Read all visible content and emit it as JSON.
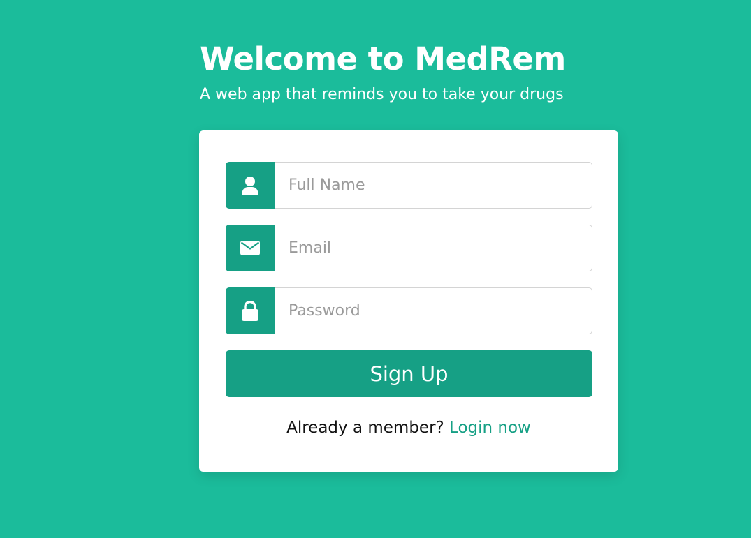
{
  "header": {
    "title": "Welcome to MedRem",
    "subtitle": "A web app that reminds you to take your drugs"
  },
  "form": {
    "fields": [
      {
        "name": "full-name",
        "icon": "user-icon",
        "placeholder": "Full Name",
        "value": ""
      },
      {
        "name": "email",
        "icon": "envelope-icon",
        "placeholder": "Email",
        "value": ""
      },
      {
        "name": "password",
        "icon": "lock-icon",
        "placeholder": "Password",
        "value": ""
      }
    ],
    "submit_label": "Sign Up"
  },
  "footer": {
    "prompt": "Already a member?",
    "link_label": "Login now"
  },
  "colors": {
    "background": "#1bbc9b",
    "accent": "#16a085",
    "card": "#ffffff"
  }
}
